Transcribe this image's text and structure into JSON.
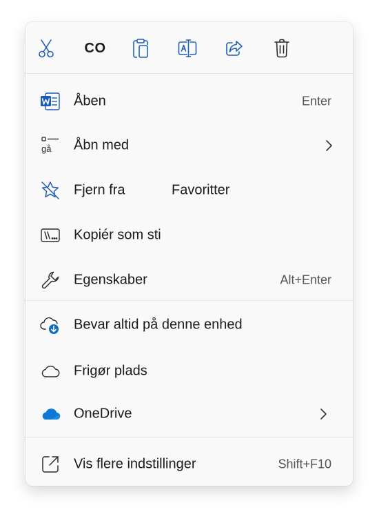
{
  "toolbar": {
    "cut_icon": "scissors-icon",
    "copy_label": "CO",
    "paste_icon": "clipboard-icon",
    "rename_icon": "rename-icon",
    "share_icon": "share-icon",
    "delete_icon": "trash-icon"
  },
  "items": [
    {
      "label": "Åben",
      "shortcut": "Enter",
      "icon": "word-icon"
    },
    {
      "label": "Åbn med",
      "icon": "open-with-icon",
      "icon_text": "gå",
      "submenu": true
    },
    {
      "label": "Fjern fra",
      "label2": "Favoritter",
      "icon": "star-off-icon"
    },
    {
      "label": "Kopiér som sti",
      "icon": "path-icon"
    },
    {
      "label": "Egenskaber",
      "shortcut": "Alt+Enter",
      "icon": "wrench-icon"
    },
    {
      "label": "Bevar altid på denne enhed",
      "icon": "cloud-download-icon"
    },
    {
      "label": "Frigør plads",
      "icon": "cloud-icon"
    },
    {
      "label": "OneDrive",
      "icon": "onedrive-icon",
      "submenu": true
    },
    {
      "label": "Vis flere indstillinger",
      "shortcut": "Shift+F10",
      "icon": "external-icon"
    }
  ],
  "colors": {
    "accent_blue": "#185abd",
    "onedrive_blue": "#0f78d4",
    "icon_gray": "#2b2b2b"
  }
}
